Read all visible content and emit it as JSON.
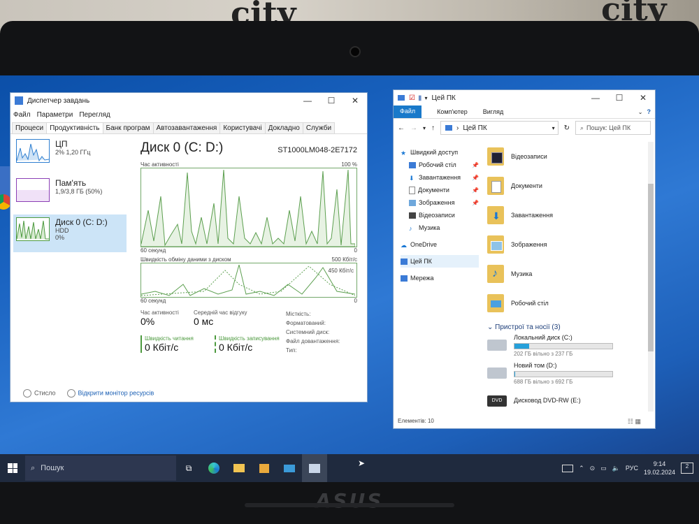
{
  "task_manager": {
    "title": "Диспетчер завдань",
    "menu": [
      "Файл",
      "Параметри",
      "Перегляд"
    ],
    "tabs": [
      "Процеси",
      "Продуктивність",
      "Банк програм",
      "Автозавантаження",
      "Користувачі",
      "Докладно",
      "Служби"
    ],
    "active_tab": "Продуктивність",
    "sidebar": [
      {
        "name": "ЦП",
        "sub1": "2% 1,20 ГГц",
        "sub2": ""
      },
      {
        "name": "Пам'ять",
        "sub1": "1,9/3,8 ГБ (50%)",
        "sub2": ""
      },
      {
        "name": "Диск 0 (C: D:)",
        "sub1": "HDD",
        "sub2": "0%"
      }
    ],
    "disk_title": "Диск 0 (C: D:)",
    "disk_model": "ST1000LM048-2E7172",
    "graph1": {
      "label": "Час активності",
      "max": "100 %",
      "time": "60 секунд",
      "min": "0"
    },
    "graph2": {
      "label": "Швидкість обміну даними з диском",
      "max": "500 Кбіт/с",
      "mid": "450 Кбіт/с",
      "time": "60 секунд",
      "min": "0"
    },
    "active_time_label": "Час активності",
    "active_time_value": "0%",
    "response_label": "Середній час відгуку",
    "response_value": "0 мс",
    "read_label": "Швидкість читання",
    "read_value": "0 Кбіт/с",
    "write_label": "Швидкість записування",
    "write_value": "0 Кбіт/с",
    "meta": [
      "Місткість:",
      "Форматований:",
      "Системний диск:",
      "Файл довантаження:",
      "Тип:"
    ],
    "footer_less": "Стисло",
    "footer_monitor": "Відкрити монітор ресурсів"
  },
  "explorer": {
    "title": "Цей ПК",
    "ribbon": [
      "Файл",
      "Комп'ютер",
      "Вигляд"
    ],
    "address": "Цей ПК",
    "search_placeholder": "Пошук: Цей ПК",
    "nav": [
      {
        "label": "Швидкий доступ",
        "level": 0,
        "pin": false
      },
      {
        "label": "Робочий стіл",
        "level": 1,
        "pin": true
      },
      {
        "label": "Завантаження",
        "level": 1,
        "pin": true
      },
      {
        "label": "Документи",
        "level": 1,
        "pin": true
      },
      {
        "label": "Зображення",
        "level": 1,
        "pin": true
      },
      {
        "label": "Відеозаписи",
        "level": 1,
        "pin": false
      },
      {
        "label": "Музика",
        "level": 1,
        "pin": false
      },
      {
        "label": "OneDrive",
        "level": 0,
        "pin": false
      },
      {
        "label": "Цей ПК",
        "level": 0,
        "pin": false
      },
      {
        "label": "Мережа",
        "level": 0,
        "pin": false
      }
    ],
    "folders": [
      "Відеозаписи",
      "Документи",
      "Завантаження",
      "Зображення",
      "Музика",
      "Робочий стіл"
    ],
    "devices_header": "Пристрої та носії (3)",
    "drives": [
      {
        "name": "Локальний диск (C:)",
        "free": "202 ГБ вільно з 237 ГБ",
        "used_fraction": 0.15
      },
      {
        "name": "Новий том (D:)",
        "free": "688 ГБ вільно з 692 ГБ",
        "used_fraction": 0.01
      },
      {
        "name": "Дисковод DVD-RW (E:)",
        "free": "",
        "used_fraction": null
      }
    ],
    "status": "Елементів: 10"
  },
  "taskbar": {
    "search_placeholder": "Пошук",
    "language": "РУС",
    "time": "9:14",
    "date": "19.02.2024",
    "notifications": "2"
  },
  "bezel": {
    "brand": "ASUS"
  }
}
